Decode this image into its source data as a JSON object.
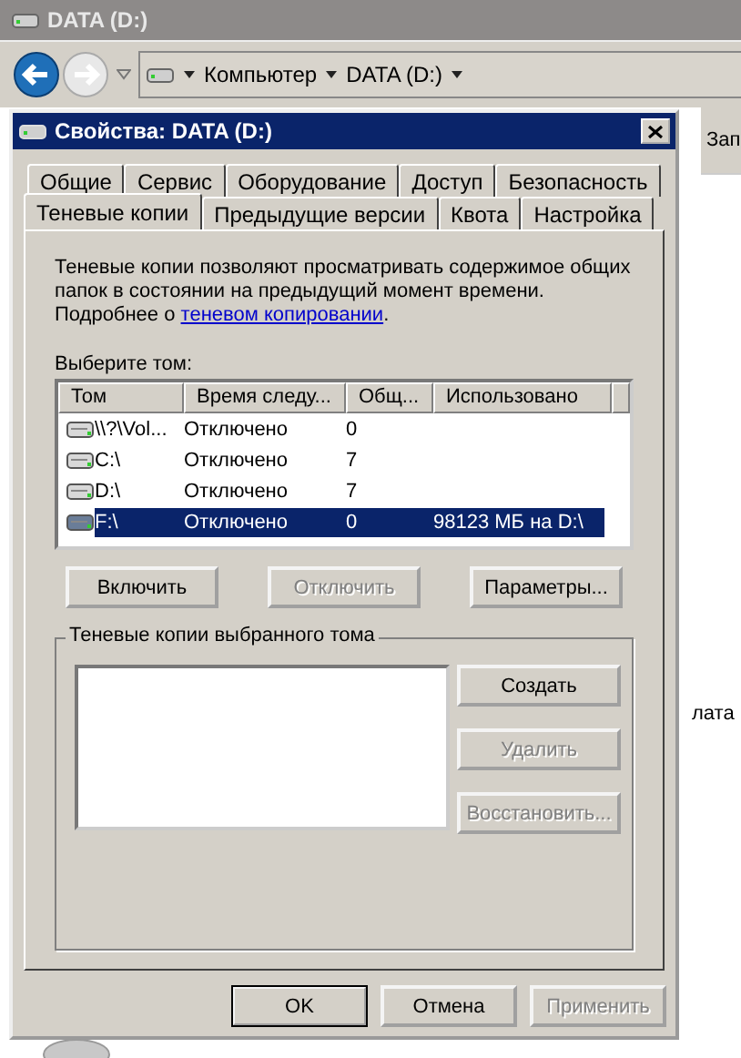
{
  "explorer": {
    "title": "DATA (D:)",
    "breadcrumb": [
      "Компьютер",
      "DATA (D:)"
    ],
    "column_header": "Зап",
    "side_text": "лата"
  },
  "dialog": {
    "title": "Свойства: DATA (D:)",
    "tabs_back": [
      {
        "label": "Общие",
        "selected": false
      },
      {
        "label": "Сервис",
        "selected": false
      },
      {
        "label": "Оборудование",
        "selected": false
      },
      {
        "label": "Доступ",
        "selected": false
      },
      {
        "label": "Безопасность",
        "selected": false
      }
    ],
    "tabs_front": [
      {
        "label": "Теневые копии",
        "selected": true
      },
      {
        "label": "Предыдущие версии",
        "selected": false
      },
      {
        "label": "Квота",
        "selected": false
      },
      {
        "label": "Настройка",
        "selected": false
      }
    ],
    "description": "Теневые копии позволяют просматривать содержимое общих папок в состоянии на предыдущий момент времени.",
    "more": {
      "prefix": "Подробнее о ",
      "link": "теневом копировании",
      "suffix": "."
    },
    "volume_label": "Выберите том:",
    "columns": [
      "Том",
      "Время следу...",
      "Общ...",
      "Использовано"
    ],
    "rows": [
      {
        "cells": [
          "\\\\?\\Vol...",
          "Отключено",
          "0",
          ""
        ],
        "selected": false
      },
      {
        "cells": [
          "C:\\",
          "Отключено",
          "7",
          ""
        ],
        "selected": false
      },
      {
        "cells": [
          "D:\\",
          "Отключено",
          "7",
          ""
        ],
        "selected": false
      },
      {
        "cells": [
          "F:\\",
          "Отключено",
          "0",
          "98123 МБ на D:\\"
        ],
        "selected": true
      }
    ],
    "volume_buttons": [
      {
        "label": "Включить",
        "disabled": false
      },
      {
        "label": "Отключить",
        "disabled": true
      },
      {
        "label": "Параметры...",
        "disabled": false
      }
    ],
    "group_title": "Теневые копии выбранного тома",
    "copy_buttons": [
      {
        "label": "Создать",
        "disabled": false
      },
      {
        "label": "Удалить",
        "disabled": true
      },
      {
        "label": "Восстановить...",
        "disabled": true
      }
    ],
    "footer_buttons": [
      {
        "label": "OK",
        "disabled": false,
        "default": true
      },
      {
        "label": "Отмена",
        "disabled": false,
        "default": false
      },
      {
        "label": "Применить",
        "disabled": true,
        "default": false
      }
    ]
  }
}
